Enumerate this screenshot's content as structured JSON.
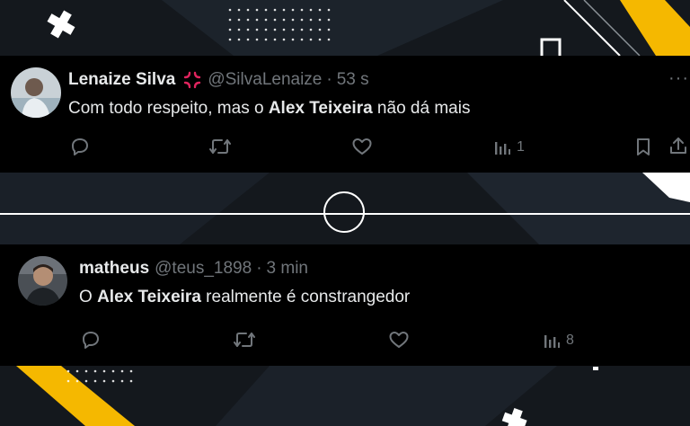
{
  "colors": {
    "background": "#14181d",
    "accent_yellow": "#f5b800",
    "tweet_bg": "#000000",
    "text": "#e7e9ea",
    "muted": "#71767b"
  },
  "tweets": [
    {
      "name": "Lenaize Silva",
      "badge_icon": "anger-symbol-emoji",
      "handle": "@SilvaLenaize",
      "separator": "·",
      "time": "53 s",
      "more": "···",
      "text_before": "Com todo respeito, mas o ",
      "text_bold": "Alex Teixeira",
      "text_after": " não dá mais",
      "views": "1"
    },
    {
      "name": "matheus",
      "handle": "@teus_1898",
      "separator": "·",
      "time": "3 min",
      "text_before": "O ",
      "text_bold": "Alex Teixeira",
      "text_after": " realmente é constrangedor",
      "views": "8"
    }
  ]
}
